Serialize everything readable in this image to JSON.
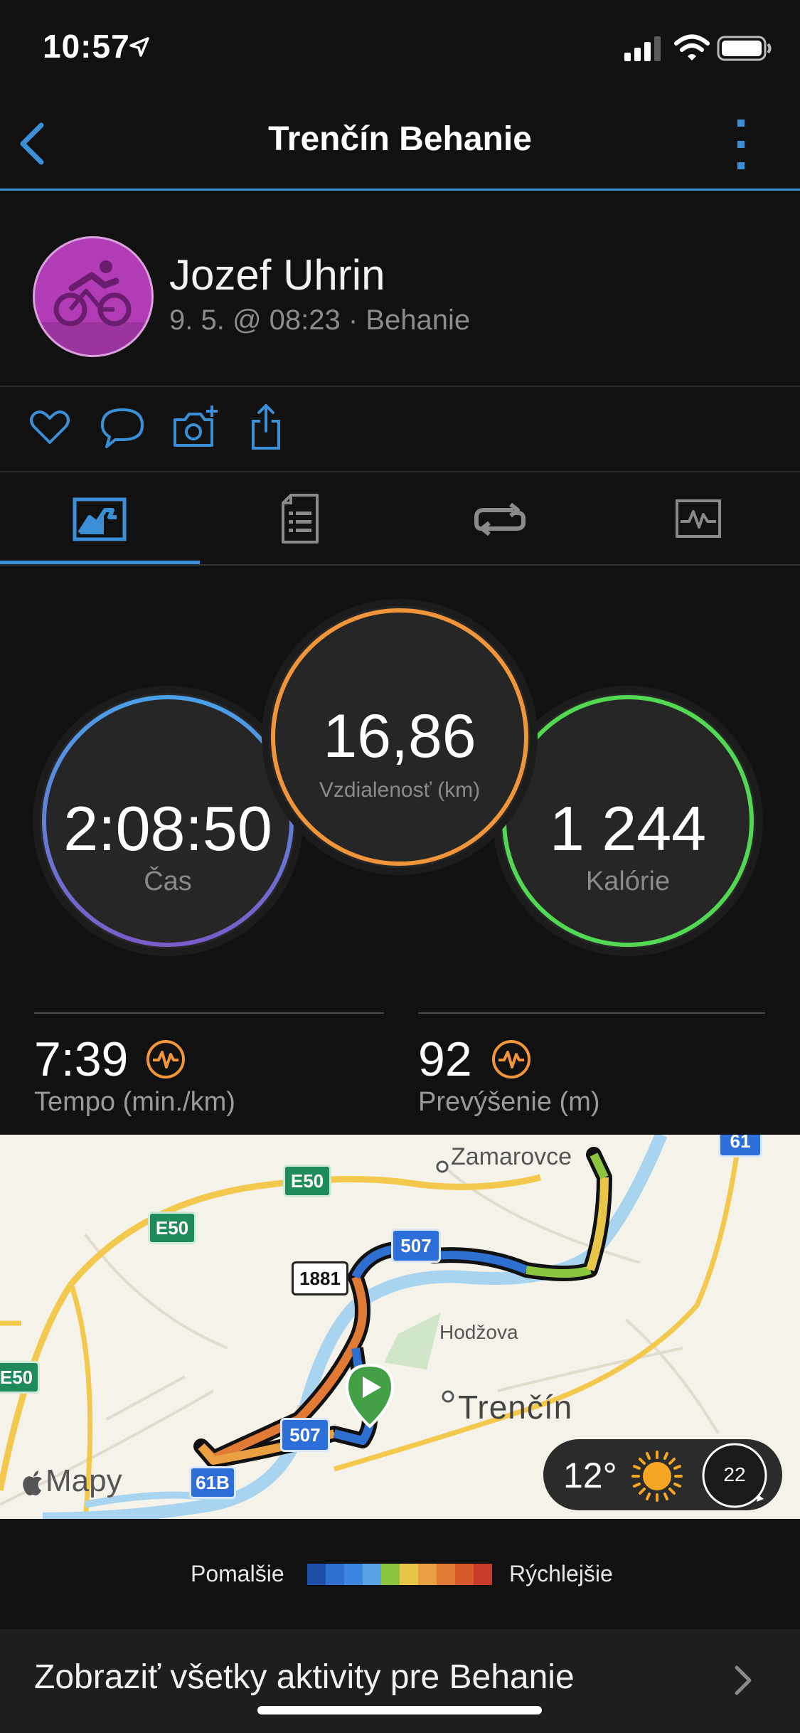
{
  "status_bar": {
    "time": "10:57"
  },
  "nav": {
    "title": "Trenčín Behanie"
  },
  "profile": {
    "name": "Jozef Uhrin",
    "meta": "9. 5. @ 08:23 · Behanie"
  },
  "rings": {
    "time": {
      "value": "2:08:50",
      "label": "Čas"
    },
    "distance": {
      "value": "16,86",
      "label": "Vzdialenosť (km)"
    },
    "calories": {
      "value": "1 244",
      "label": "Kalórie"
    }
  },
  "stats": [
    {
      "value": "7:39",
      "label": "Tempo (min./km)"
    },
    {
      "value": "92",
      "label": "Prevýšenie (m)"
    }
  ],
  "map": {
    "labels": {
      "zamarovce": "Zamarovce",
      "hodzova": "Hodžova",
      "trencin": "Trenčín",
      "attribution": "Mapy"
    },
    "shields": {
      "e50_a": "E50",
      "e50_b": "E50",
      "e50_c": "E50",
      "r1881": "1881",
      "r507_a": "507",
      "r507_b": "507",
      "r61b": "61B",
      "r61": "61"
    },
    "weather": {
      "temp": "12°",
      "wind": "22"
    }
  },
  "legend": {
    "slower": "Pomalšie",
    "faster": "Rýchlejšie",
    "colors": [
      "#1f4fa8",
      "#2f6fd0",
      "#3b86e0",
      "#5aa2e6",
      "#8cc63f",
      "#e8c64a",
      "#eaa040",
      "#e07a35",
      "#d85a2a",
      "#c83a2a"
    ]
  },
  "footer": {
    "text": "Zobraziť všetky aktivity pre Behanie"
  },
  "colors": {
    "accent": "#3b8fd6",
    "orange": "#f0953a",
    "green": "#53d853"
  }
}
